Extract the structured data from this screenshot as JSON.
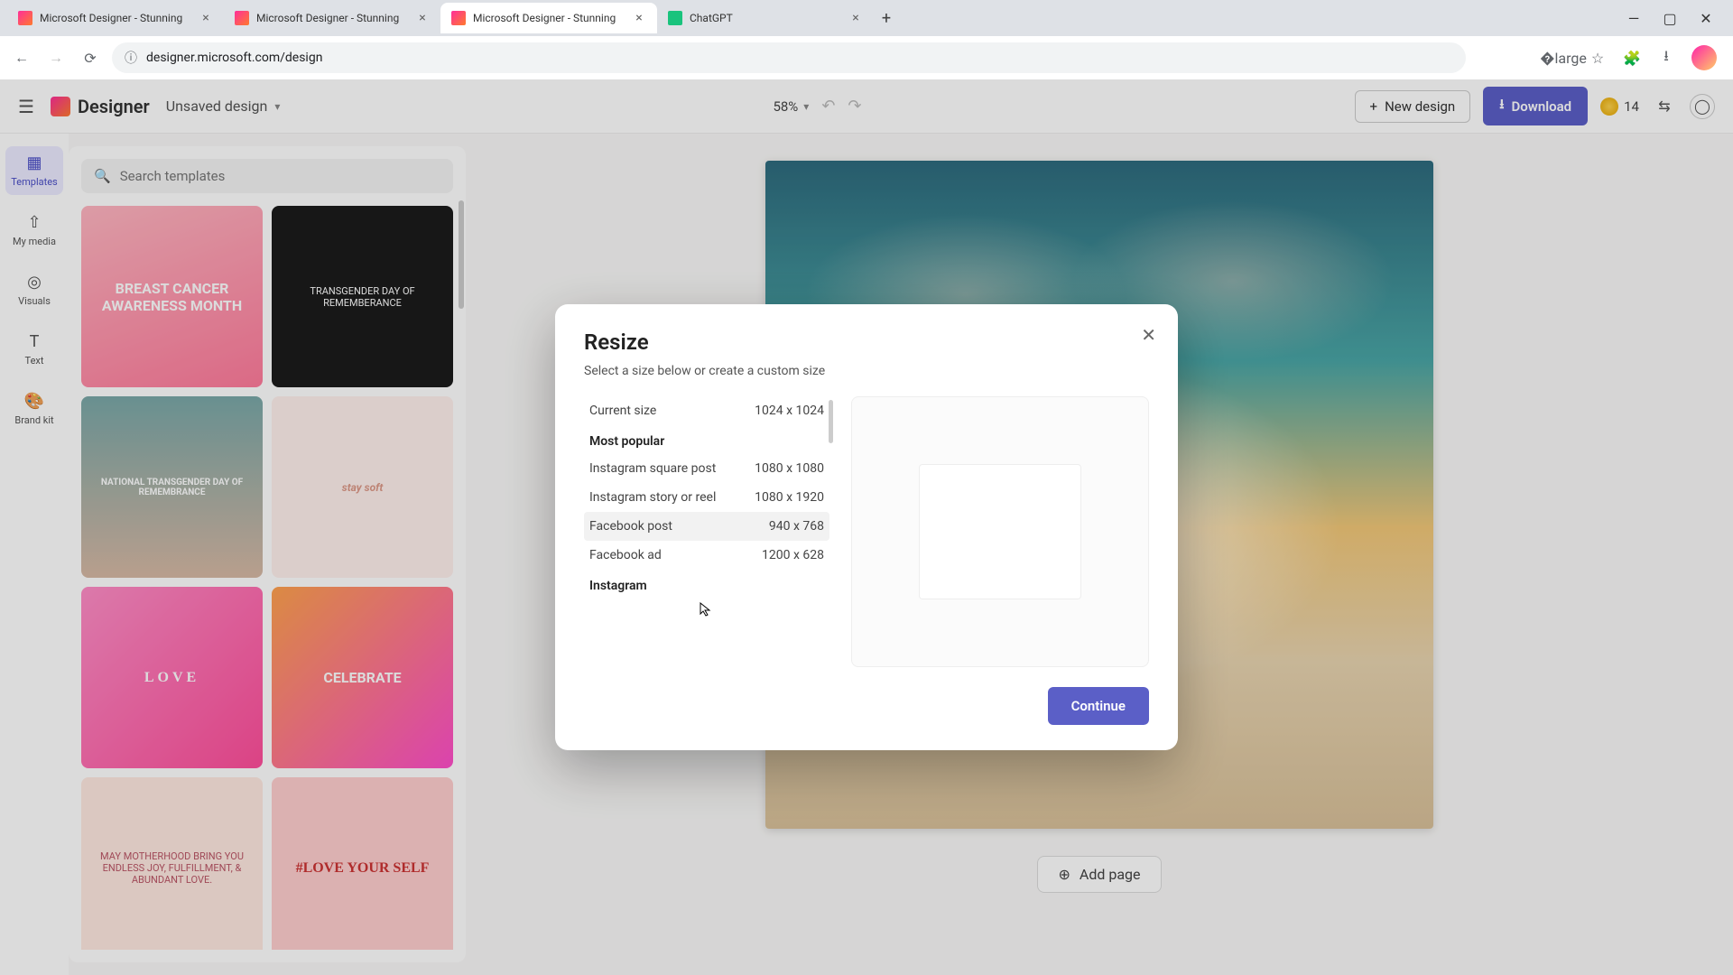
{
  "browser": {
    "tabs": [
      {
        "title": "Microsoft Designer - Stunning"
      },
      {
        "title": "Microsoft Designer - Stunning"
      },
      {
        "title": "Microsoft Designer - Stunning"
      },
      {
        "title": "ChatGPT"
      }
    ],
    "active_tab_index": 2,
    "url": "designer.microsoft.com/design"
  },
  "topbar": {
    "app_name": "Designer",
    "design_name": "Unsaved design",
    "zoom": "58%",
    "new_design": "New design",
    "download": "Download",
    "credits": "14"
  },
  "rail": {
    "items": [
      {
        "label": "Templates"
      },
      {
        "label": "My media"
      },
      {
        "label": "Visuals"
      },
      {
        "label": "Text"
      },
      {
        "label": "Brand kit"
      }
    ],
    "active_index": 0
  },
  "side_panel": {
    "search_placeholder": "Search templates",
    "templates": [
      "BREAST CANCER AWARENESS MONTH",
      "TRANSGENDER DAY OF REMEMBERANCE",
      "NATIONAL TRANSGENDER DAY OF REMEMBRANCE",
      "stay soft",
      "LOVE",
      "CELEBRATE",
      "MAY MOTHERHOOD BRING YOU ENDLESS JOY, FULFILLMENT, & ABUNDANT LOVE.",
      "#LOVE YOUR SELF"
    ]
  },
  "canvas": {
    "add_page": "Add page"
  },
  "modal": {
    "title": "Resize",
    "subtitle": "Select a size below or create a custom size",
    "current_size_label": "Current size",
    "current_size_value": "1024 x 1024",
    "sections": [
      {
        "header": "Most popular",
        "items": [
          {
            "label": "Instagram square post",
            "value": "1080 x 1080"
          },
          {
            "label": "Instagram story or reel",
            "value": "1080 x 1920"
          },
          {
            "label": "Facebook post",
            "value": "940 x 768"
          },
          {
            "label": "Facebook ad",
            "value": "1200 x 628"
          }
        ]
      },
      {
        "header": "Instagram",
        "items": []
      }
    ],
    "hover_index": 2,
    "continue": "Continue"
  }
}
